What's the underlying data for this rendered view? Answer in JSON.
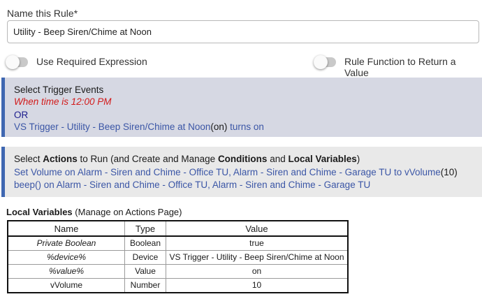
{
  "rule_name": {
    "label": "Name this Rule*",
    "value": "Utility - Beep Siren/Chime at Noon"
  },
  "toggles": {
    "required_expression": {
      "label": "Use Required Expression",
      "on": false
    },
    "rule_function": {
      "label": "Rule Function to Return a Value",
      "on": false
    }
  },
  "triggers": {
    "heading": "Select Trigger Events",
    "time_trigger": "When time is 12:00 PM",
    "or_text": "OR",
    "device_trigger_prefix": "VS Trigger - Utility - Beep Siren/Chime at Noon",
    "device_trigger_state": "(on)",
    "device_trigger_suffix": " turns on"
  },
  "actions": {
    "heading_pre": "Select ",
    "heading_actions": "Actions",
    "heading_mid1": " to Run (and Create and Manage ",
    "heading_conditions": "Conditions",
    "heading_mid2": " and ",
    "heading_local_vars": "Local Variables",
    "heading_post": ")",
    "action1_text": "Set Volume on Alarm - Siren and Chime - Office TU, Alarm - Siren and Chime - Garage TU to vVolume",
    "action1_value": "(10)",
    "action2_text": "beep() on Alarm - Siren and Chime - Office TU, Alarm - Siren and Chime - Garage TU"
  },
  "local_variables": {
    "heading_bold": "Local Variables",
    "heading_note": " (Manage on Actions Page)",
    "columns": [
      "Name",
      "Type",
      "Value"
    ],
    "rows": [
      {
        "name": "Private Boolean",
        "type": "Boolean",
        "value": "true"
      },
      {
        "name": "%device%",
        "type": "Device",
        "value": "VS Trigger - Utility - Beep Siren/Chime at Noon"
      },
      {
        "name": "%value%",
        "type": "Value",
        "value": "on"
      },
      {
        "name": "vVolume",
        "type": "Number",
        "value": "10"
      }
    ]
  },
  "colors": {
    "accent_bar": "#3f67b1",
    "trigger_panel_bg": "#d6d8e3",
    "actions_panel_bg": "#e9e9e9",
    "time_trigger_text": "#d21a1a",
    "link_text": "#3b56a6"
  }
}
